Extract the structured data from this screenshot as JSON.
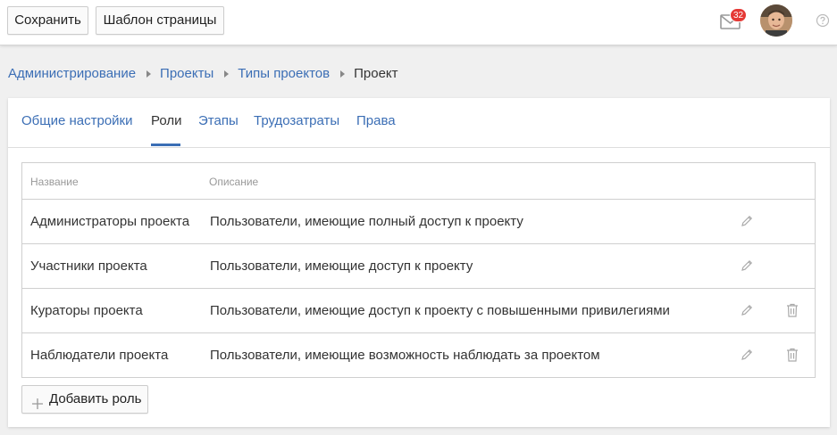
{
  "toolbar": {
    "save_label": "Сохранить",
    "template_label": "Шаблон страницы"
  },
  "notifications": {
    "count": "32",
    "icon": "mail-icon"
  },
  "user": {
    "avatar_icon": "avatar"
  },
  "help": {
    "icon": "help-icon"
  },
  "breadcrumb": [
    "Администрирование",
    "Проекты",
    "Типы проектов",
    "Проект"
  ],
  "tabs": [
    {
      "label": "Общие настройки",
      "active": false
    },
    {
      "label": "Роли",
      "active": true
    },
    {
      "label": "Этапы",
      "active": false
    },
    {
      "label": "Трудозатраты",
      "active": false
    },
    {
      "label": "Права",
      "active": false
    }
  ],
  "table": {
    "columns": [
      "Название",
      "Описание"
    ],
    "rows": [
      {
        "name": "Администраторы проекта",
        "description": "Пользователи, имеющие полный доступ к проекту",
        "editable": true,
        "deletable": false
      },
      {
        "name": "Участники проекта",
        "description": "Пользователи, имеющие доступ к проекту",
        "editable": true,
        "deletable": false
      },
      {
        "name": "Кураторы проекта",
        "description": "Пользователи, имеющие доступ к проекту с повышенными привилегиями",
        "editable": true,
        "deletable": true
      },
      {
        "name": "Наблюдатели проекта",
        "description": "Пользователи, имеющие возможность наблюдать за проектом",
        "editable": true,
        "deletable": true
      }
    ]
  },
  "add_role_label": "Добавить роль",
  "colors": {
    "link": "#3b6eb5",
    "badge": "#e53935",
    "active_tab_underline": "#3b6eb5"
  }
}
